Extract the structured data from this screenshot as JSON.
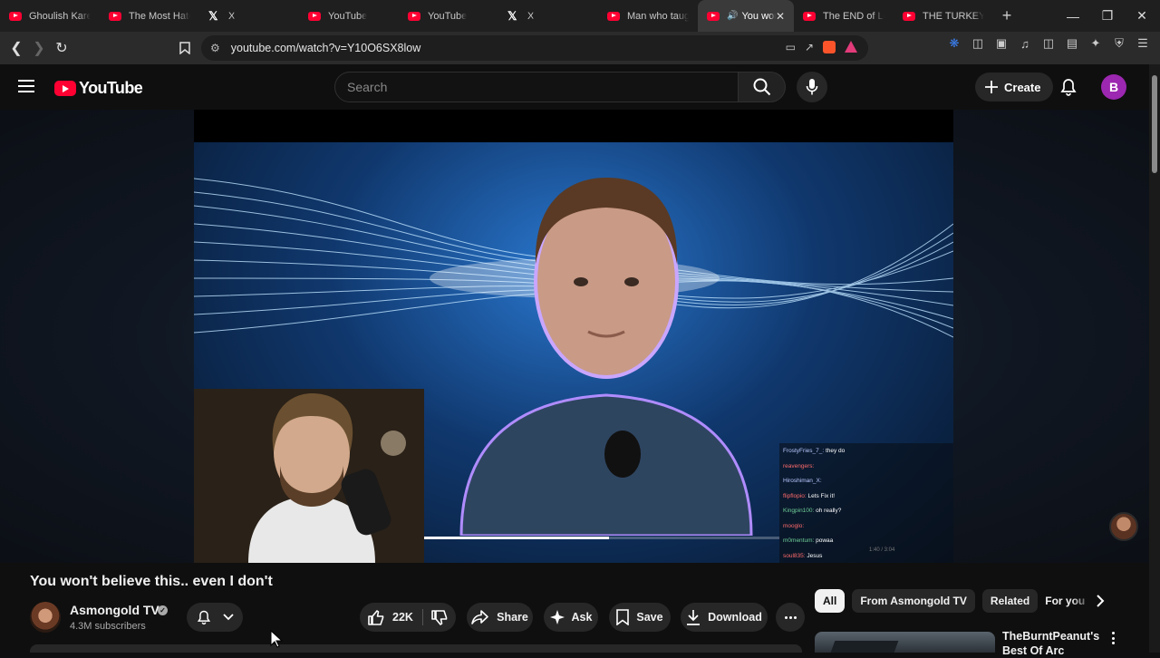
{
  "browser": {
    "tabs": [
      {
        "label": "Ghoulish Karen",
        "icon": "youtube-icon"
      },
      {
        "label": "The Most Hated",
        "icon": "youtube-icon"
      },
      {
        "label": "X",
        "icon": "x-icon"
      },
      {
        "label": "YouTube",
        "icon": "youtube-icon"
      },
      {
        "label": "YouTube",
        "icon": "youtube-icon"
      },
      {
        "label": "X",
        "icon": "x-icon"
      },
      {
        "label": "Man who taught",
        "icon": "youtube-icon"
      },
      {
        "label": "You won",
        "icon": "youtube-icon",
        "active": true
      },
      {
        "label": "The END of Lol",
        "icon": "youtube-icon"
      },
      {
        "label": "THE TURKEY TO",
        "icon": "youtube-icon"
      }
    ],
    "url": "youtube.com/watch?v=Y10O6SX8low"
  },
  "header": {
    "logo_text": "YouTube",
    "search_placeholder": "Search",
    "create_label": "Create",
    "avatar_letter": "B",
    "avatar_color": "#9c27b0"
  },
  "player": {
    "progress": 0.52,
    "timestamp": "1:40 / 3:04",
    "chat": [
      {
        "user": "FrostyFries_7_:",
        "text": " they do",
        "cls": "u1"
      },
      {
        "user": "reavengers:",
        "text": "",
        "cls": "u2"
      },
      {
        "user": "Hiroshiman_X:",
        "text": "",
        "cls": "u1"
      },
      {
        "user": "flipflopio:",
        "text": " Lets Fix it!",
        "cls": "u2"
      },
      {
        "user": "Kingpin100:",
        "text": " oh really?",
        "cls": "u3"
      },
      {
        "user": "mooglo:",
        "text": "",
        "cls": "u2"
      },
      {
        "user": "m0mentum:",
        "text": " powaa",
        "cls": "u3"
      },
      {
        "user": "soul835:",
        "text": " Jesus",
        "cls": "u2"
      }
    ]
  },
  "video": {
    "title": "You won't believe this.. even I don't",
    "channel": "Asmongold TV",
    "subscribers": "4.3M subscribers",
    "likes": "22K",
    "share_label": "Share",
    "ask_label": "Ask",
    "save_label": "Save",
    "download_label": "Download"
  },
  "sidebar": {
    "chips": [
      "All",
      "From Asmongold TV",
      "Related",
      "For you"
    ],
    "recommendation": {
      "title": "TheBurntPeanut's Best Of Arc"
    }
  },
  "colors": {
    "accent": "#ff0033",
    "background": "#0f0f0f",
    "surface": "#272727"
  }
}
